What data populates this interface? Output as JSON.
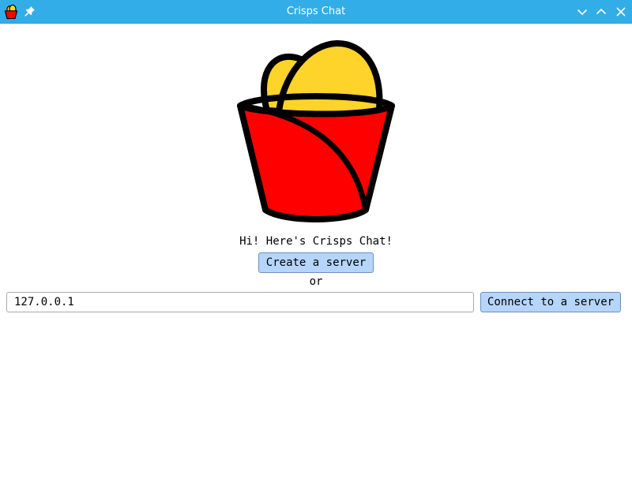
{
  "window": {
    "title": "Crisps Chat",
    "app_icon": "crisps-bucket-icon",
    "pin_icon": "pin-icon",
    "controls": [
      "minimize-icon",
      "maximize-icon",
      "close-icon"
    ],
    "accent_color": "#33ade8"
  },
  "main": {
    "logo": "crisps-bucket-logo",
    "greeting": "Hi! Here's Crisps Chat!",
    "create_label": "Create a server",
    "or_label": "or",
    "address_value": "127.0.0.1",
    "connect_label": "Connect to a server",
    "button_color": "#b5d5fb",
    "bucket_color": "#ff0000",
    "crisp_color": "#ffd42a"
  }
}
